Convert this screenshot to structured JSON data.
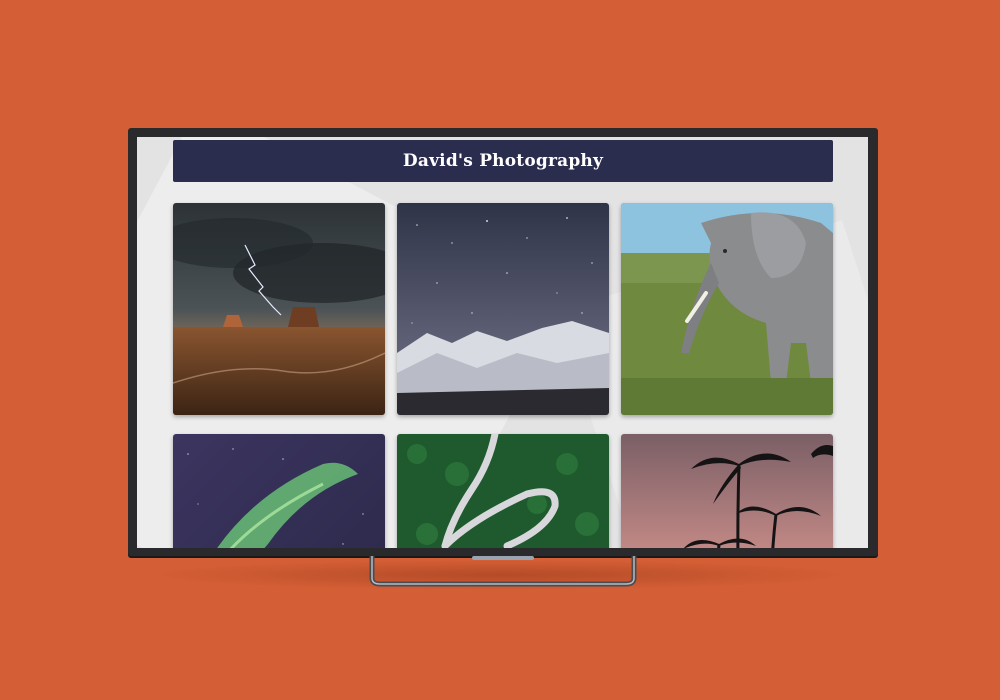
{
  "header": {
    "title": "David's Photography"
  },
  "gallery": {
    "photos": [
      {
        "subject": "desert butte with lightning storm"
      },
      {
        "subject": "snowy mountains under starry night sky"
      },
      {
        "subject": "elephant in grassland"
      },
      {
        "subject": "green aurora borealis over purple sky"
      },
      {
        "subject": "winding road through green forest aerial"
      },
      {
        "subject": "palm tree silhouettes at pink sunset"
      }
    ]
  },
  "colors": {
    "background": "#d45e35",
    "header": "#2a2d4d",
    "screen": "#e3e3e4"
  }
}
